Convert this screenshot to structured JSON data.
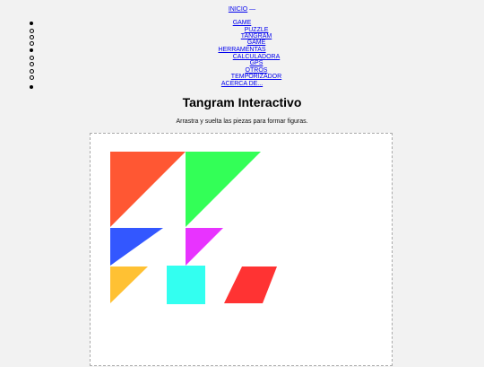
{
  "topnav": {
    "inicio": "INICIO",
    "separator": "—"
  },
  "menu": [
    {
      "label": "GAME",
      "subitems": [
        "PUZZLE",
        "TANGRAM",
        "GAME"
      ]
    },
    {
      "label": "HERRAMENTAS",
      "subitems": [
        "CALCULADORA",
        "GPS",
        "OTROS",
        "TEMPORIZADOR"
      ]
    },
    {
      "label": "ACERCA DE...",
      "subitems": []
    }
  ],
  "page": {
    "title": "Tangram Interactivo",
    "subtitle": "Arrastra y suelta las piezas para formar figuras."
  },
  "pieces": [
    {
      "name": "large-triangle-orange",
      "color": "#ff5733"
    },
    {
      "name": "large-triangle-green",
      "color": "#33ff57"
    },
    {
      "name": "medium-triangle-blue",
      "color": "#3357ff"
    },
    {
      "name": "small-triangle-magenta",
      "color": "#e833ff"
    },
    {
      "name": "small-triangle-yellow",
      "color": "#ffc133"
    },
    {
      "name": "square-cyan",
      "color": "#33fff0"
    },
    {
      "name": "parallelogram-red",
      "color": "#ff3333"
    }
  ]
}
